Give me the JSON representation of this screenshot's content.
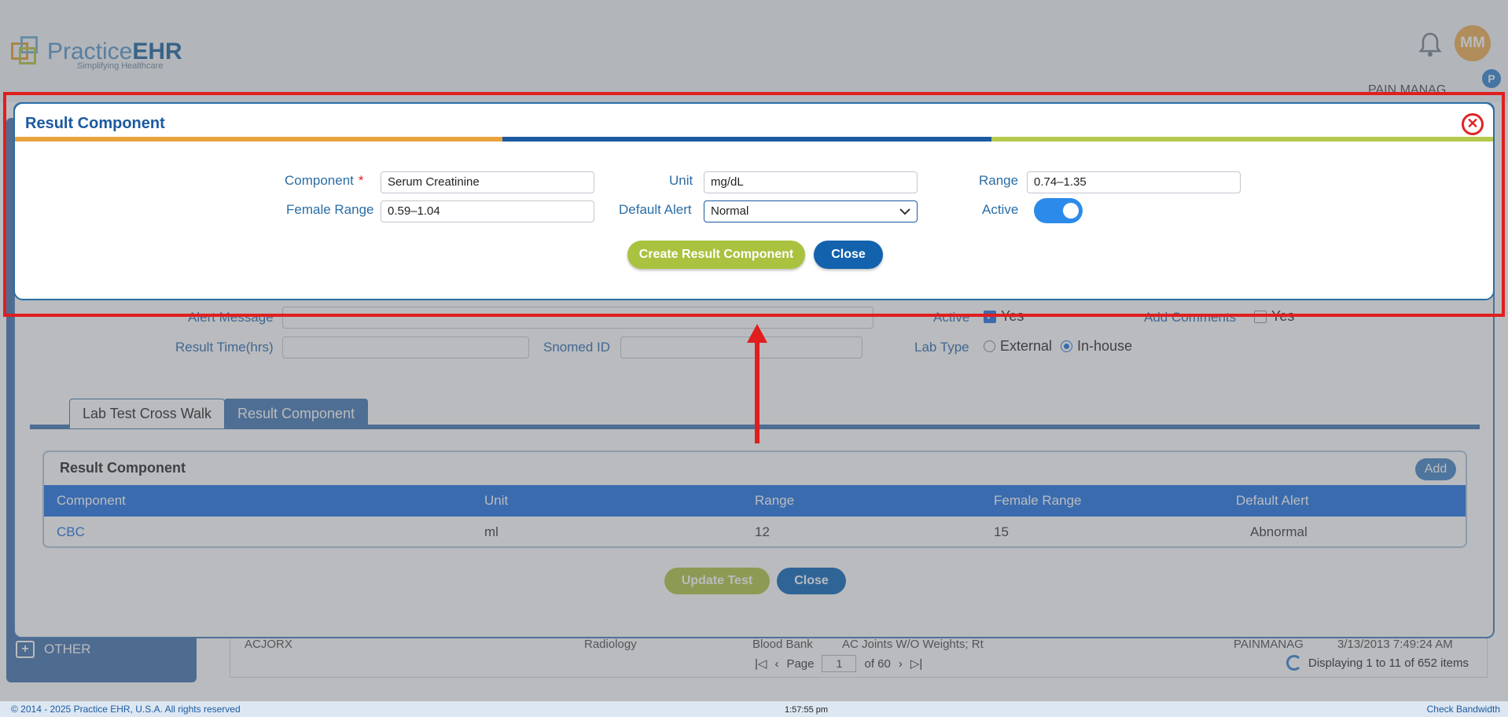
{
  "app": {
    "logo_text_light": "Practice",
    "logo_text_bold": "EHR",
    "logo_tagline": "Simplifying Healthcare",
    "avatar_initials": "MM",
    "badge_letter": "P",
    "practice_name": "PAIN MANAG ..."
  },
  "sidebar": {
    "other_label": "OTHER"
  },
  "background_grid": {
    "row": [
      "ACJORX",
      "Radiology",
      "Blood Bank",
      "AC Joints W/O Weights; Rt",
      "PAINMANAG",
      "3/13/2013 7:49:24 AM"
    ],
    "pager": {
      "page_label": "Page",
      "page_value": "1",
      "of_label": "of 60"
    },
    "displaying": "Displaying 1 to 11 of 652 items"
  },
  "test_form": {
    "alert_message_label": "Alert Message",
    "result_time_label": "Result Time(hrs)",
    "snomed_label": "Snomed ID",
    "active_label": "Active",
    "active_yes": "Yes",
    "add_comments_label": "Add Comments",
    "add_comments_yes": "Yes",
    "lab_type_label": "Lab Type",
    "lab_type_external": "External",
    "lab_type_inhouse": "In-house",
    "tabs": [
      "Lab Test Cross Walk",
      "Result Component"
    ],
    "panel_title": "Result Component",
    "add_label": "Add",
    "columns": [
      "Component",
      "Unit",
      "Range",
      "Female Range",
      "Default Alert"
    ],
    "rows": [
      {
        "component": "CBC",
        "unit": "ml",
        "range": "12",
        "female_range": "15",
        "default_alert": "Abnormal"
      }
    ],
    "update_label": "Update Test",
    "close_label": "Close"
  },
  "modal": {
    "title": "Result Component",
    "component_label": "Component",
    "required_mark": "*",
    "component_value": "Serum Creatinine",
    "unit_label": "Unit",
    "unit_value": "mg/dL",
    "range_label": "Range",
    "range_value": "0.74–1.35",
    "female_range_label": "Female Range",
    "female_range_value": "0.59–1.04",
    "default_alert_label": "Default Alert",
    "default_alert_value": "Normal",
    "active_label": "Active",
    "active_on": true,
    "create_label": "Create Result Component",
    "close_label": "Close",
    "colors": {
      "stripe_orange": "#e9a23b",
      "stripe_blue": "#1c5aa0",
      "stripe_green": "#b6c94d",
      "annotation_red": "#e01e1e"
    }
  },
  "footer": {
    "copyright": "© 2014 - 2025 Practice EHR, U.S.A. All rights reserved",
    "time": "1:57:55 pm",
    "bandwidth": "Check Bandwidth"
  }
}
